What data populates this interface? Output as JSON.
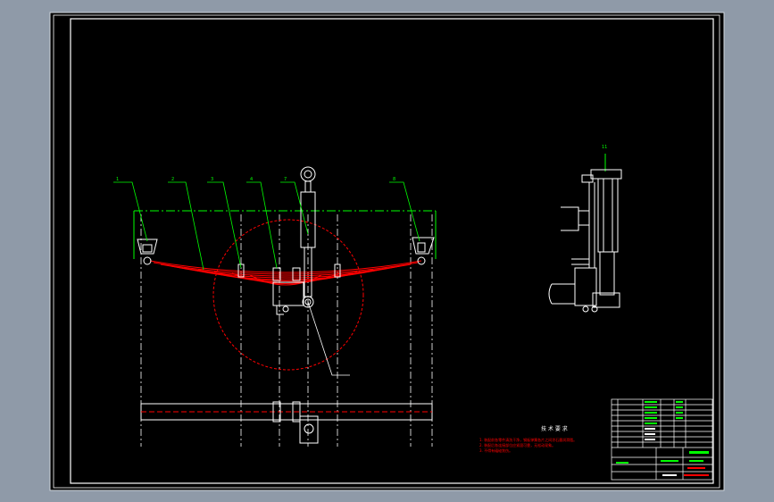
{
  "drawing": {
    "balloons": [
      "1",
      "2",
      "3",
      "4",
      "7",
      "8"
    ],
    "side_view_balloon": "11",
    "tech_requirements": {
      "title": "技 术 要 求",
      "items": [
        "1. 装配前各零件清洗干净，钢板弹簧各片之间涂石墨润滑脂。",
        "2. 装配后各连接部位应紧固可靠，无松动现象。",
        "3. 不得有磕碰划伤。"
      ]
    },
    "colors": {
      "sheet": "#000000",
      "frame": "#ffffff",
      "center_line": "#00ff00",
      "leaf_spring": "#ff0000",
      "circle": "#ff0000",
      "text_note": "#ff0000",
      "title_block_text": "#00ff00"
    }
  }
}
